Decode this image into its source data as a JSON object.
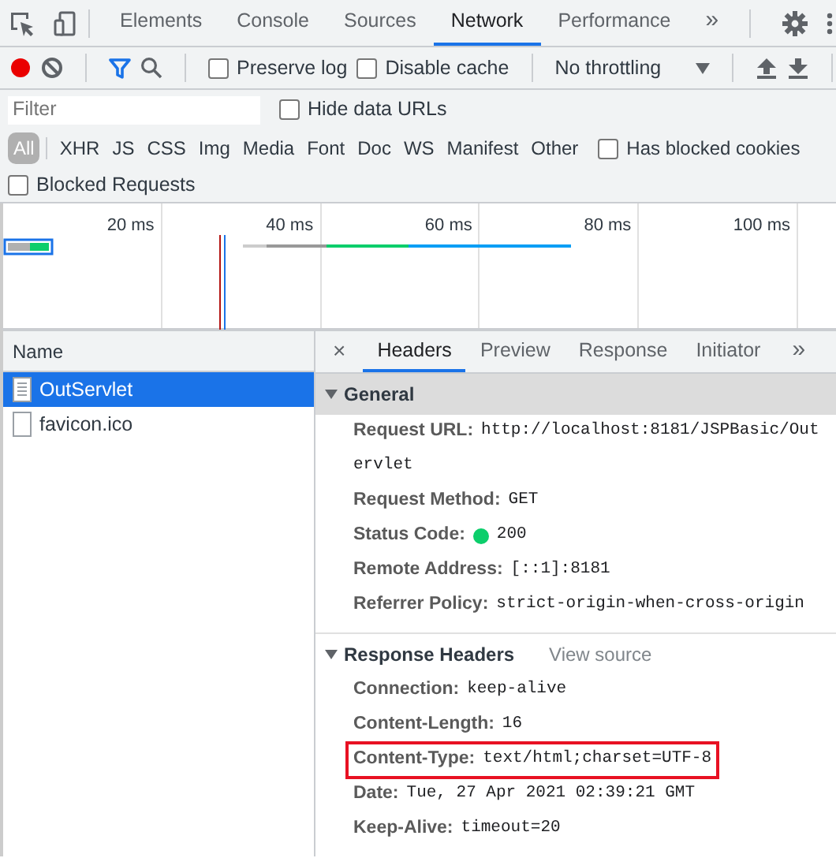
{
  "main_tabs": [
    {
      "label": "Elements",
      "selected": false
    },
    {
      "label": "Console",
      "selected": false
    },
    {
      "label": "Sources",
      "selected": false
    },
    {
      "label": "Network",
      "selected": true
    },
    {
      "label": "Performance",
      "selected": false
    }
  ],
  "more_tabs": "»",
  "toolbar": {
    "recording": true,
    "checkboxes": [
      {
        "label": "Preserve log",
        "checked": false
      },
      {
        "label": "Disable cache",
        "checked": false
      }
    ],
    "throttling": "No throttling"
  },
  "filter": {
    "placeholder": "Filter",
    "option": {
      "label": "Hide data URLs",
      "checked": false
    }
  },
  "type_filters": [
    {
      "label": "All",
      "selected": true
    },
    {
      "label": "XHR",
      "selected": false
    },
    {
      "label": "JS",
      "selected": false
    },
    {
      "label": "CSS",
      "selected": false
    },
    {
      "label": "Img",
      "selected": false
    },
    {
      "label": "Media",
      "selected": false
    },
    {
      "label": "Font",
      "selected": false
    },
    {
      "label": "Doc",
      "selected": false
    },
    {
      "label": "WS",
      "selected": false
    },
    {
      "label": "Manifest",
      "selected": false
    },
    {
      "label": "Other",
      "selected": false
    }
  ],
  "extra_options": [
    {
      "label": "Has blocked cookies",
      "checked": false
    },
    {
      "label": "Blocked Requests",
      "checked": false
    }
  ],
  "overview": {
    "ticks": [
      "20 ms",
      "40 ms",
      "60 ms",
      "80 ms",
      "100 ms"
    ]
  },
  "requests": {
    "column": "Name",
    "rows": [
      {
        "name": "OutServlet",
        "kind": "document",
        "selected": true
      },
      {
        "name": "favicon.ico",
        "kind": "blank",
        "selected": false
      }
    ]
  },
  "details": {
    "close": "×",
    "tabs": [
      {
        "label": "Headers",
        "selected": true
      },
      {
        "label": "Preview",
        "selected": false
      },
      {
        "label": "Response",
        "selected": false
      },
      {
        "label": "Initiator",
        "selected": false
      }
    ],
    "more": "»",
    "sections": [
      {
        "title": "General",
        "expanded": true,
        "rows": [
          {
            "key": "Request URL:",
            "value": "http://localhost:8181/JSPBasic/Out",
            "continuation": "ervlet",
            "kind": "text"
          },
          {
            "key": "Request Method:",
            "value": "GET",
            "kind": "text"
          },
          {
            "key": "Status Code:",
            "value": "200",
            "kind": "status"
          },
          {
            "key": "Remote Address:",
            "value": "[::1]:8181",
            "kind": "text"
          },
          {
            "key": "Referrer Policy:",
            "value": "strict-origin-when-cross-origin",
            "kind": "text"
          }
        ]
      },
      {
        "title": "Response Headers",
        "expanded": true,
        "link": "View source",
        "rows": [
          {
            "key": "Connection:",
            "value": "keep-alive",
            "kind": "text",
            "highlighted": false
          },
          {
            "key": "Content-Length:",
            "value": "16",
            "kind": "text",
            "highlighted": false
          },
          {
            "key": "Content-Type:",
            "value": "text/html;charset=UTF-8",
            "kind": "text",
            "highlighted": true
          },
          {
            "key": "Date:",
            "value": "Tue, 27 Apr 2021 02:39:21 GMT",
            "kind": "text",
            "highlighted": false
          },
          {
            "key": "Keep-Alive:",
            "value": "timeout=20",
            "kind": "text",
            "highlighted": false
          }
        ]
      }
    ]
  }
}
